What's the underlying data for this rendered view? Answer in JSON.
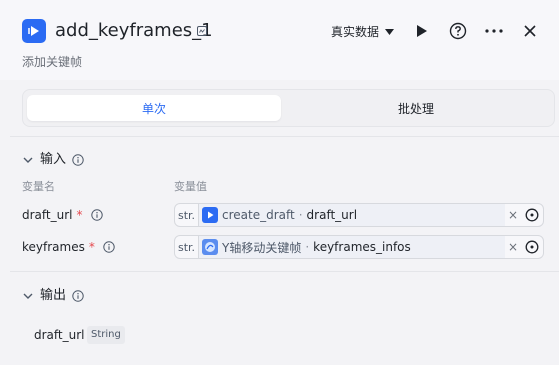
{
  "header": {
    "title": "add_keyframes_1",
    "subtitle": "添加关键帧",
    "data_source": "真实数据",
    "icons": [
      "play-icon",
      "help-icon",
      "more-icon",
      "close-icon"
    ]
  },
  "mode_tabs": [
    "单次",
    "批处理"
  ],
  "active_tab": 0,
  "inputs": {
    "section_title": "输入",
    "col_name": "变量名",
    "col_value": "变量值",
    "rows": [
      {
        "label": "draft_url",
        "required": "*",
        "type": "str.",
        "node": "create_draft",
        "sep": "·",
        "param": "draft_url",
        "clear": "×"
      },
      {
        "label": "keyframes",
        "required": "*",
        "type": "str.",
        "node": "Y轴移动关键帧",
        "sep": "·",
        "param": "keyframes_infos",
        "clear": "×"
      }
    ]
  },
  "outputs": {
    "section_title": "输出",
    "rows": [
      {
        "name": "draft_url",
        "type": "String"
      }
    ]
  },
  "colors": {
    "accent": "#2b6bf3",
    "required": "#e5484d",
    "background": "#f3f3f6"
  }
}
